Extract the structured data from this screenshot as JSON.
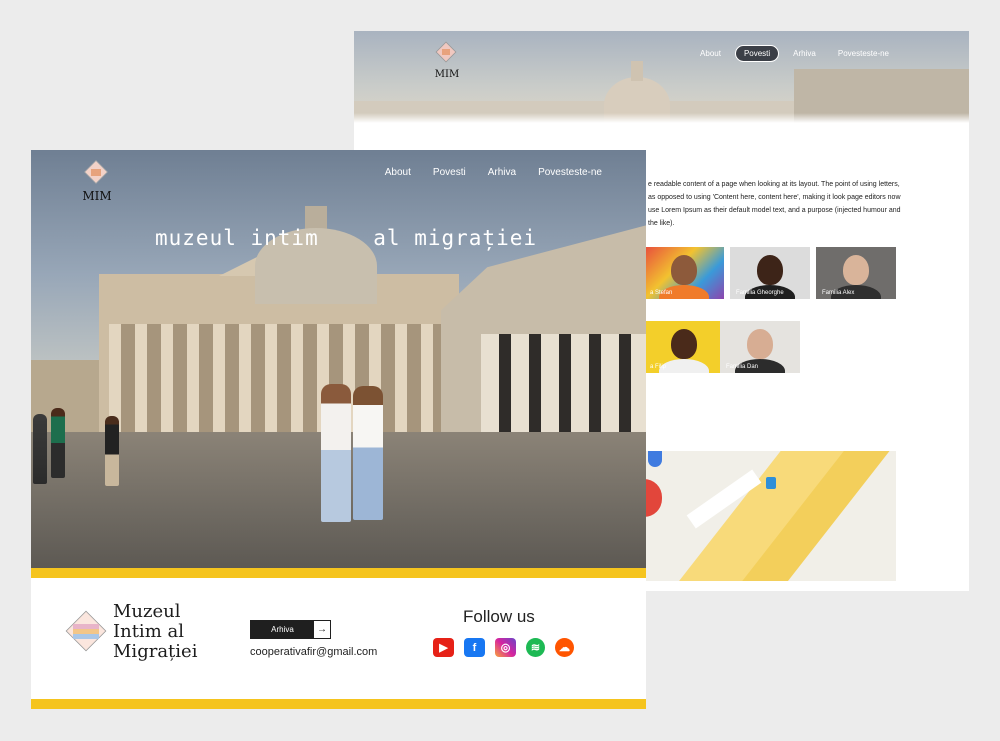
{
  "back": {
    "logo_text": "MIM",
    "nav": [
      "About",
      "Povesti",
      "Arhiva",
      "Povesteste-ne"
    ],
    "nav_active": "Povesti",
    "paragraph": "e readable content of a page when looking at its layout. The point of using letters, as opposed to using 'Content here, content here', making it look page editors now use Lorem Ipsum as their default model text, and a purpose (injected humour and the like).",
    "people": [
      {
        "caption": "a Stefan"
      },
      {
        "caption": "Familia Gheorghe"
      },
      {
        "caption": "Familia Alex"
      },
      {
        "caption": "a Filip"
      },
      {
        "caption": "Familia Dan"
      }
    ]
  },
  "front": {
    "logo_text": "MIM",
    "nav": [
      "About",
      "Povesti",
      "Arhiva",
      "Povesteste-ne"
    ],
    "tagline": "muzeul intim    al migrației",
    "footer": {
      "name_lines": [
        "Muzeul",
        "Intim al",
        "Migrației"
      ],
      "archive_button": "Arhiva",
      "archive_arrow": "→",
      "email": "cooperativafir@gmail.com",
      "follow": "Follow us",
      "socials": [
        {
          "icon": "youtube-icon",
          "color": "#e62117"
        },
        {
          "icon": "facebook-icon",
          "color": "#1877f2"
        },
        {
          "icon": "instagram-icon",
          "color": "#d6249f"
        },
        {
          "icon": "spotify-icon",
          "color": "#1db954"
        },
        {
          "icon": "soundcloud-icon",
          "color": "#ff5500"
        }
      ]
    }
  },
  "colors": {
    "accent_yellow": "#f5c41e",
    "nav_active_bg": "#3b3f47"
  }
}
